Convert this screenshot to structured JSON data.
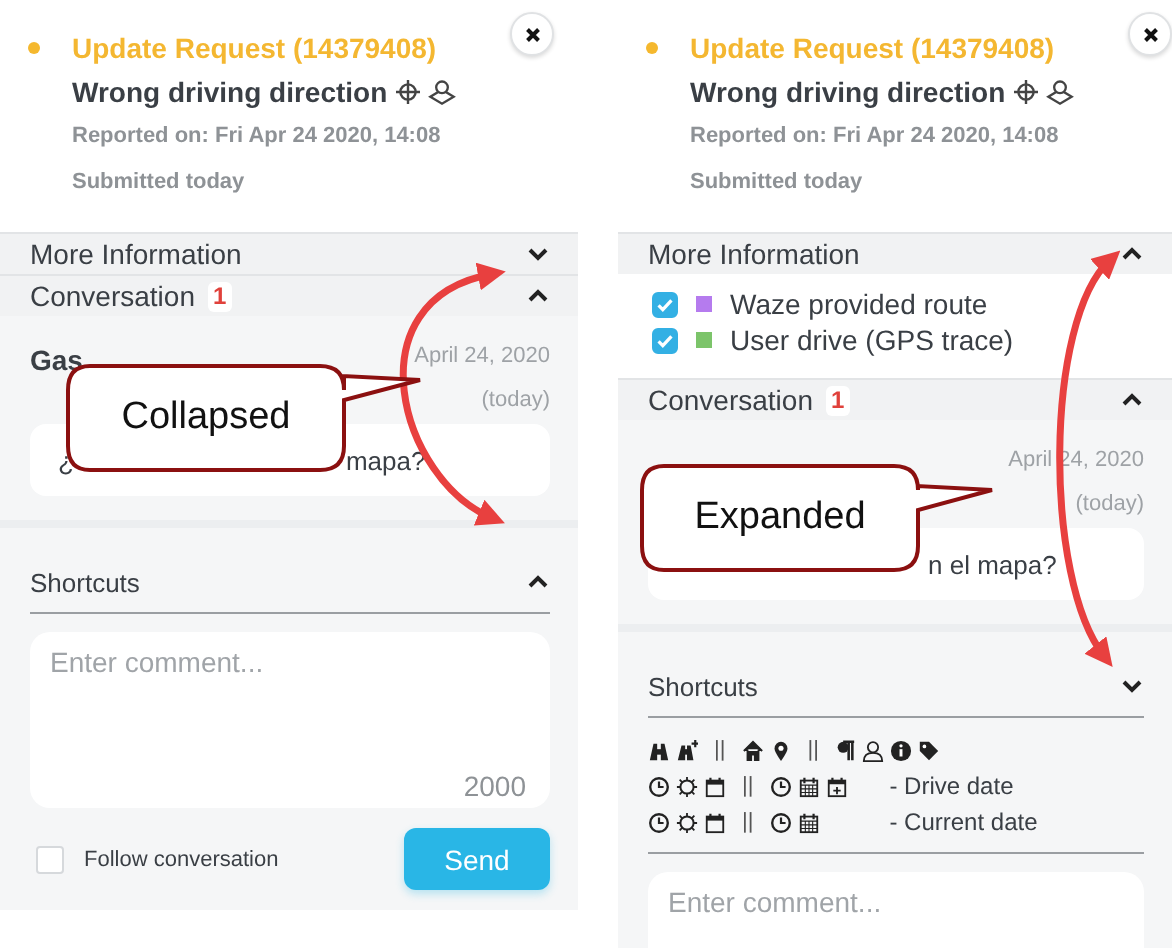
{
  "panels": [
    {
      "header": {
        "title": "Update Request (14379408)",
        "subtitle": "Wrong driving direction",
        "reported": "Reported on: Fri Apr 24 2020, 14:08",
        "submitted": "Submitted today"
      },
      "more_information": {
        "label": "More Information",
        "expanded": false
      },
      "conversation": {
        "label": "Conversation",
        "count": "1",
        "expanded": true,
        "message": {
          "author": "Gas",
          "date": "April 24, 2020",
          "relative": "(today)",
          "text_parts": [
            "¿",
            "mapa?"
          ]
        }
      },
      "shortcuts": {
        "label": "Shortcuts",
        "expanded": false
      },
      "comment": {
        "placeholder": "Enter comment...",
        "counter": "2000"
      },
      "follow": {
        "label": "Follow conversation",
        "checked": false
      },
      "send": "Send"
    },
    {
      "header": {
        "title": "Update Request (14379408)",
        "subtitle": "Wrong driving direction",
        "reported": "Reported on: Fri Apr 24 2020, 14:08",
        "submitted": "Submitted today"
      },
      "more_information": {
        "label": "More Information",
        "expanded": true,
        "layers": [
          {
            "label": "Waze provided route",
            "checked": true,
            "color": "#b57bee"
          },
          {
            "label": "User drive (GPS trace)",
            "checked": true,
            "color": "#7cc46a"
          }
        ]
      },
      "conversation": {
        "label": "Conversation",
        "count": "1",
        "expanded": true,
        "message": {
          "date": "April 24, 2020",
          "relative": "(today)",
          "text_parts": [
            "n el mapa?"
          ]
        }
      },
      "shortcuts": {
        "label": "Shortcuts",
        "expanded": true,
        "rows": [
          {
            "separators": [
              "||",
              "||"
            ]
          },
          {
            "separators": [
              "||"
            ],
            "label": "- Drive date"
          },
          {
            "separators": [
              "||"
            ],
            "label": "- Current date"
          }
        ]
      },
      "comment": {
        "placeholder": "Enter comment..."
      }
    }
  ],
  "annotations": [
    {
      "text": "Collapsed"
    },
    {
      "text": "Expanded"
    }
  ]
}
